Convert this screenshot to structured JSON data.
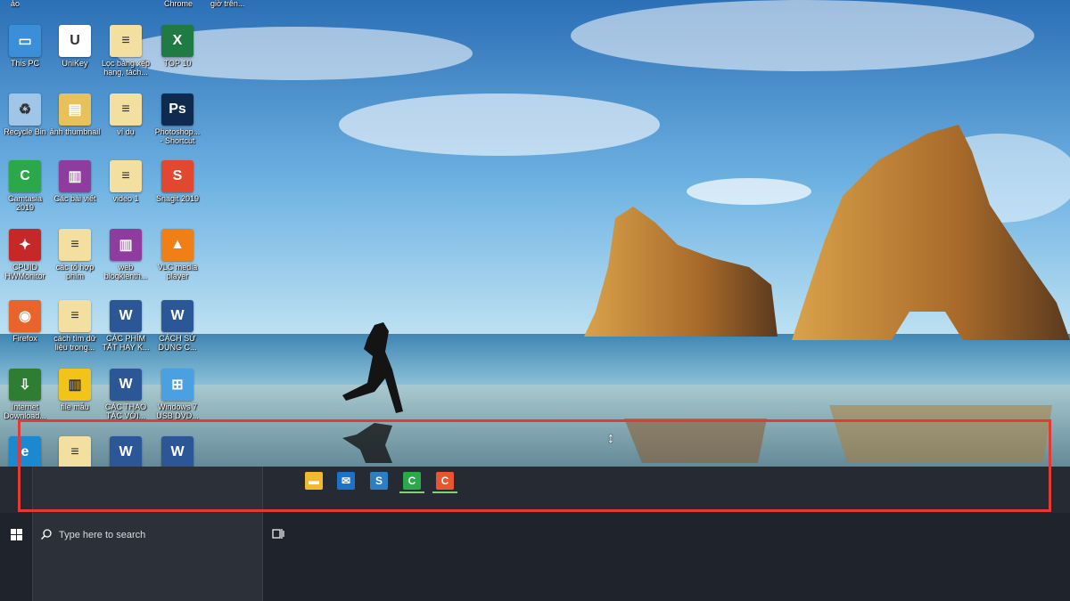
{
  "top_row_labels": [
    "ảo",
    "Chrome",
    "giờ trên..."
  ],
  "desktop_icons": [
    {
      "label": "This PC",
      "icon": "computer-icon",
      "color": "#3b8fd9",
      "glyph": "▭"
    },
    {
      "label": "UniKey",
      "icon": "unikey-icon",
      "color": "#ffffff",
      "glyph": "U"
    },
    {
      "label": "Lọc bảng xếp\nhạng, tách...",
      "icon": "text-file-icon",
      "color": "#f3e0a0",
      "glyph": "≡"
    },
    {
      "label": "TOP 10",
      "icon": "excel-icon",
      "color": "#1f7a44",
      "glyph": "X"
    },
    {
      "label": "Recycle Bin",
      "icon": "recycle-bin-icon",
      "color": "#9fc5e8",
      "glyph": "♻"
    },
    {
      "label": "ảnh thumbnail",
      "icon": "folder-icon",
      "color": "#e8c15a",
      "glyph": "▤"
    },
    {
      "label": "ví dụ",
      "icon": "text-file-icon",
      "color": "#f3e0a0",
      "glyph": "≡"
    },
    {
      "label": "Photoshop...\n- Shortcut",
      "icon": "photoshop-icon",
      "color": "#0e2a4f",
      "glyph": "Ps"
    },
    {
      "label": "Camtasia\n2019",
      "icon": "camtasia-icon",
      "color": "#2aa84a",
      "glyph": "C"
    },
    {
      "label": "Các bài viết",
      "icon": "archive-icon",
      "color": "#8e3d9e",
      "glyph": "▥"
    },
    {
      "label": "video 1",
      "icon": "text-file-icon",
      "color": "#f3e0a0",
      "glyph": "≡"
    },
    {
      "label": "Snagit 2019",
      "icon": "snagit-icon",
      "color": "#e2482f",
      "glyph": "S"
    },
    {
      "label": "CPUID\nHWMonitor",
      "icon": "hwmonitor-icon",
      "color": "#c62828",
      "glyph": "✦"
    },
    {
      "label": "các tổ hợp\nphím",
      "icon": "text-file-icon",
      "color": "#f3e0a0",
      "glyph": "≡"
    },
    {
      "label": "web\nblogkienth...",
      "icon": "archive-icon",
      "color": "#8e3d9e",
      "glyph": "▥"
    },
    {
      "label": "VLC media\nplayer",
      "icon": "vlc-icon",
      "color": "#f07f16",
      "glyph": "▲"
    },
    {
      "label": "Firefox",
      "icon": "firefox-icon",
      "color": "#e8642b",
      "glyph": "◉"
    },
    {
      "label": "cách tìm dữ\nliệu trong...",
      "icon": "text-file-icon",
      "color": "#f3e0a0",
      "glyph": "≡"
    },
    {
      "label": "CÁC PHÍM\nTẮT HAY K...",
      "icon": "word-icon",
      "color": "#2b5797",
      "glyph": "W"
    },
    {
      "label": "CÁCH SỬ\nDỤNG C...",
      "icon": "word-icon",
      "color": "#2b5797",
      "glyph": "W"
    },
    {
      "label": "Internet\nDownload...",
      "icon": "idm-icon",
      "color": "#2e7d32",
      "glyph": "⇩"
    },
    {
      "label": "file mẫu",
      "icon": "zip-icon",
      "color": "#f2c318",
      "glyph": "▥"
    },
    {
      "label": "CÁC THAO\nTÁC VỚI...",
      "icon": "word-icon",
      "color": "#2b5797",
      "glyph": "W"
    },
    {
      "label": "Windows 7\nUSB DVD...",
      "icon": "windows7-usb-icon",
      "color": "#4aa0e0",
      "glyph": "⊞"
    },
    {
      "label": "",
      "icon": "edge-icon",
      "color": "#1b89d0",
      "glyph": "e"
    },
    {
      "label": "",
      "icon": "text-file-icon",
      "color": "#f3e0a0",
      "glyph": "≡"
    },
    {
      "label": "",
      "icon": "word-icon",
      "color": "#2b5797",
      "glyph": "W"
    },
    {
      "label": "",
      "icon": "word-icon",
      "color": "#2b5797",
      "glyph": "W"
    }
  ],
  "taskbar": {
    "search_placeholder": "Type here to search",
    "pinned": [
      {
        "icon": "file-explorer-icon",
        "color": "#f2b830",
        "glyph": "▬",
        "active": false
      },
      {
        "icon": "mail-icon",
        "color": "#1a73c8",
        "glyph": "✉",
        "active": false
      },
      {
        "icon": "snagit-icon",
        "color": "#2d7fc1",
        "glyph": "S",
        "active": false
      },
      {
        "icon": "camtasia-icon",
        "color": "#2aa84a",
        "glyph": "C",
        "active": true
      },
      {
        "icon": "camtasia-recorder-icon",
        "color": "#e8552f",
        "glyph": "C",
        "active": true
      }
    ]
  },
  "colors": {
    "highlight": "#e53935",
    "active_underline": "#7ed56f"
  }
}
